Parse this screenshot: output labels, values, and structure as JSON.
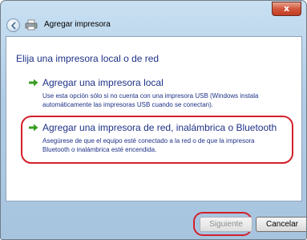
{
  "window": {
    "title": "Agregar impresora",
    "close_glyph": "x",
    "back_icon": "back-arrow-icon",
    "printer_icon": "printer-icon"
  },
  "main": {
    "heading": "Elija una impresora local o de red",
    "options": [
      {
        "title": "Agregar una impresora local",
        "description": "Use esta opción sólo si no cuenta con una impresora USB (Windows instala automáticamente las impresoras USB cuando se conectan).",
        "icon": "green-arrow-icon"
      },
      {
        "title": "Agregar una impresora de red, inalámbrica o Bluetooth",
        "description": "Asegúrese de que el equipo esté conectado a la red o de que la impresora Bluetooth o inalámbrica esté encendida.",
        "icon": "green-arrow-icon"
      }
    ]
  },
  "footer": {
    "next_label": "Siguiente",
    "cancel_label": "Cancelar"
  },
  "colors": {
    "link_blue": "#1e3287",
    "annotation_red": "#d2202a",
    "arrow_green": "#3a9d23"
  }
}
